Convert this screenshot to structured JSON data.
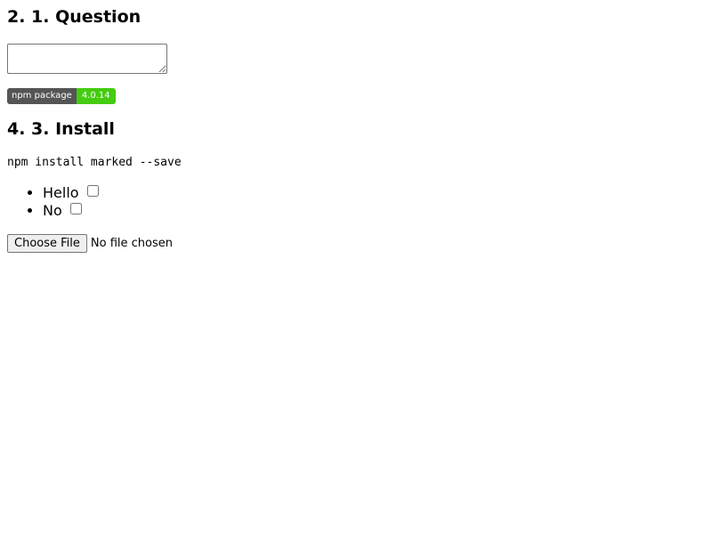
{
  "sections": {
    "question_heading": "2. 1. Question",
    "install_heading": "4. 3. Install"
  },
  "textarea": {
    "value": ""
  },
  "badge": {
    "label": "npm package",
    "version": "4.0.14",
    "label_color": "#555555",
    "version_color": "#44cc11"
  },
  "install_command": "npm install marked --save",
  "options": [
    {
      "label": "Hello",
      "checked": false
    },
    {
      "label": "No",
      "checked": false
    }
  ],
  "file_input": {
    "button_label": "Choose File",
    "status": "No file chosen"
  }
}
